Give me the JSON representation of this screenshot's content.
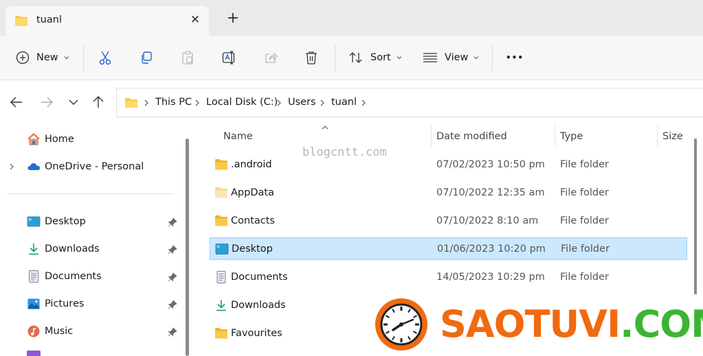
{
  "window": {
    "tab_title": "tuanl",
    "close_label": "✕",
    "new_tab_label": "+"
  },
  "toolbar": {
    "new_label": "New",
    "sort_label": "Sort",
    "view_label": "View",
    "more_label": "•••"
  },
  "address": {
    "crumbs": [
      "This PC",
      "Local Disk (C:)",
      "Users",
      "tuanl"
    ]
  },
  "sidebar": {
    "items": [
      {
        "label": "Home",
        "icon": "home-icon",
        "pinned": false
      },
      {
        "label": "OneDrive - Personal",
        "icon": "onedrive-icon",
        "pinned": false
      },
      {
        "label": "Desktop",
        "icon": "desktop-icon",
        "pinned": true
      },
      {
        "label": "Downloads",
        "icon": "downloads-icon",
        "pinned": true
      },
      {
        "label": "Documents",
        "icon": "documents-icon",
        "pinned": true
      },
      {
        "label": "Pictures",
        "icon": "pictures-icon",
        "pinned": true
      },
      {
        "label": "Music",
        "icon": "music-icon",
        "pinned": true
      }
    ]
  },
  "filelist": {
    "columns": [
      "Name",
      "Date modified",
      "Type",
      "Size"
    ],
    "rows": [
      {
        "name": ".android",
        "date": "07/02/2023 10:50 pm",
        "type": "File folder",
        "icon": "folder-icon",
        "selected": false
      },
      {
        "name": "AppData",
        "date": "07/10/2022 12:35 am",
        "type": "File folder",
        "icon": "folder-icon",
        "selected": false
      },
      {
        "name": "Contacts",
        "date": "07/10/2022 8:10 am",
        "type": "File folder",
        "icon": "folder-icon",
        "selected": false
      },
      {
        "name": "Desktop",
        "date": "01/06/2023 10:20 pm",
        "type": "File folder",
        "icon": "desktop-icon",
        "selected": true
      },
      {
        "name": "Documents",
        "date": "14/05/2023 10:29 pm",
        "type": "File folder",
        "icon": "documents-icon",
        "selected": false
      },
      {
        "name": "Downloads",
        "date": "",
        "type": "",
        "icon": "downloads-icon",
        "selected": false
      },
      {
        "name": "Favourites",
        "date": "",
        "type": "",
        "icon": "folder-icon",
        "selected": false
      }
    ]
  },
  "watermarks": {
    "blog": "blogcntt.com",
    "brand_orange": "SAOTUVI",
    "brand_green": ".COM"
  },
  "colors": {
    "accent_selected": "#cce8ff",
    "folder_yellow": "#f8c94a",
    "brand_orange": "#f06a10",
    "brand_green": "#3cb531"
  }
}
